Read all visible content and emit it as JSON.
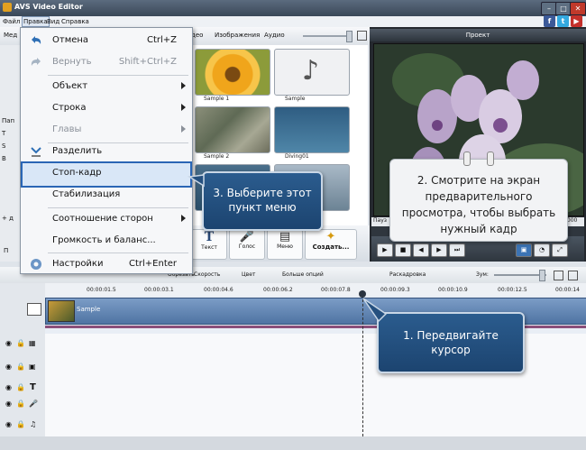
{
  "app": {
    "title": "AVS Video Editor"
  },
  "menubar": {
    "file": "Файл",
    "edit": "Правка",
    "view": "Вид",
    "help": "Справка"
  },
  "mediatabs": {
    "media_short": "Мед",
    "video_short": "део",
    "images": "Изображения",
    "audio": "Аудио"
  },
  "left_panel": {
    "pane_label": "Пап",
    "folder1": "Т",
    "folder2": "S",
    "folder3": "В",
    "add_label": "+ д",
    "bottom_label": "П"
  },
  "thumbnails": [
    {
      "label": "Sample 1"
    },
    {
      "label": "Sample"
    },
    {
      "label": "Sample 2"
    },
    {
      "label": "Diving01"
    }
  ],
  "bottom_tools": {
    "text": "Текст",
    "voice": "Голос",
    "menu": "Меню",
    "create": "Создать..."
  },
  "preview": {
    "header": "Проект",
    "pause_label": "Пауз",
    "time_end": ",000"
  },
  "edit_menu": {
    "items": [
      {
        "label": "Отмена",
        "shortcut": "Ctrl+Z"
      },
      {
        "label": "Вернуть",
        "shortcut": "Shift+Ctrl+Z"
      },
      {
        "label": "Объект"
      },
      {
        "label": "Строка"
      },
      {
        "label": "Главы"
      },
      {
        "label": "Разделить"
      },
      {
        "label": "Стоп-кадр"
      },
      {
        "label": "Стабилизация"
      },
      {
        "label": "Соотношение сторон"
      },
      {
        "label": "Громкость и баланс..."
      },
      {
        "label": "Настройки",
        "shortcut": "Ctrl+Enter"
      }
    ]
  },
  "timeline_toolbar": {
    "cut": "Обрезать",
    "speed": "Скорость",
    "color": "Цвет",
    "more": "Больше опций",
    "storyboard": "Раскадровка",
    "zoom": "Зум:"
  },
  "ruler": [
    "00:00:01.5",
    "00:00:03.1",
    "00:00:04.6",
    "00:00:06.2",
    "00:00:07.8",
    "00:00:09.3",
    "00:00:10.9",
    "00:00:12.5",
    "00:00:14"
  ],
  "timeline": {
    "clip_label": "Sample"
  },
  "callouts": {
    "step1": "1. Передвигайте курсор",
    "step2": "2. Смотрите на экран предварительного просмотра, чтобы выбрать нужный кадр",
    "step3": "3. Выберите этот пункт меню"
  },
  "colors": {
    "accent": "#1c4470",
    "highlight_border": "#2a66b5"
  }
}
